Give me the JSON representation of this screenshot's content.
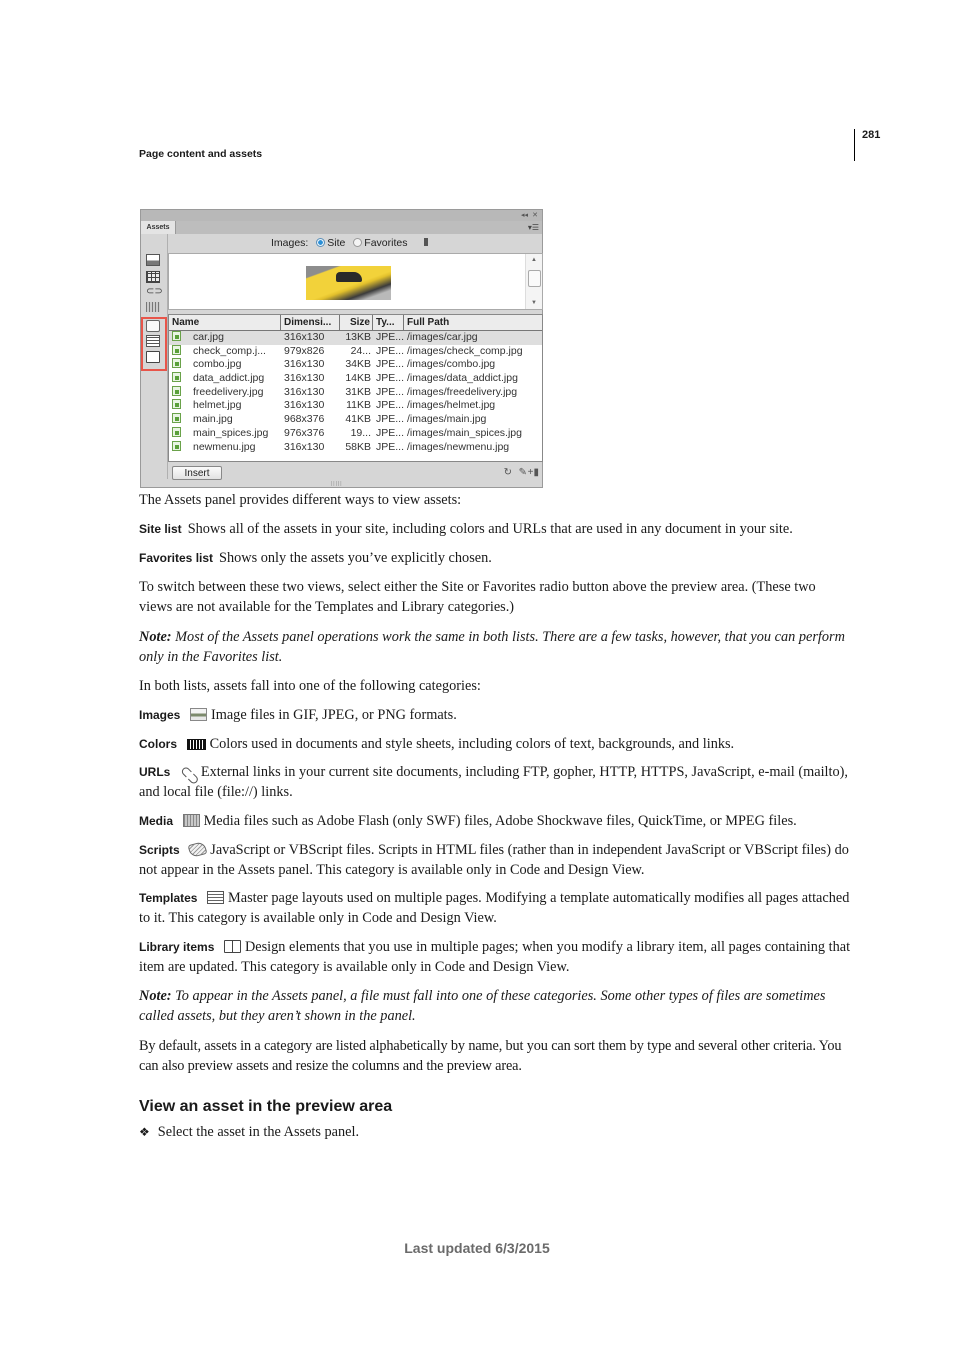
{
  "header": {
    "page_number": "281",
    "running_head": "Page content and assets"
  },
  "panel": {
    "tab_label": "Assets",
    "titlebar_icons": [
      "collapse-icon",
      "close-icon"
    ],
    "category_label": "Images:",
    "radio_site": "Site",
    "radio_favorites": "Favorites",
    "selected_view": "Site",
    "columns": [
      "Name",
      "Dimensi...",
      "Size",
      "Ty...",
      "Full Path"
    ],
    "rows": [
      {
        "name": "car.jpg",
        "dim": "316x130",
        "size": "13KB",
        "type": "JPE...",
        "path": "/images/car.jpg"
      },
      {
        "name": "check_comp.j...",
        "dim": "979x826",
        "size": "24...",
        "type": "JPE...",
        "path": "/images/check_comp.jpg"
      },
      {
        "name": "combo.jpg",
        "dim": "316x130",
        "size": "34KB",
        "type": "JPE...",
        "path": "/images/combo.jpg"
      },
      {
        "name": "data_addict.jpg",
        "dim": "316x130",
        "size": "14KB",
        "type": "JPE...",
        "path": "/images/data_addict.jpg"
      },
      {
        "name": "freedelivery.jpg",
        "dim": "316x130",
        "size": "31KB",
        "type": "JPE...",
        "path": "/images/freedelivery.jpg"
      },
      {
        "name": "helmet.jpg",
        "dim": "316x130",
        "size": "11KB",
        "type": "JPE...",
        "path": "/images/helmet.jpg"
      },
      {
        "name": "main.jpg",
        "dim": "968x376",
        "size": "41KB",
        "type": "JPE...",
        "path": "/images/main.jpg"
      },
      {
        "name": "main_spices.jpg",
        "dim": "976x376",
        "size": "19...",
        "type": "JPE...",
        "path": "/images/main_spices.jpg"
      },
      {
        "name": "newmenu.jpg",
        "dim": "316x130",
        "size": "58KB",
        "type": "JPE...",
        "path": "/images/newmenu.jpg"
      }
    ],
    "insert_label": "Insert",
    "highlight_color": "#e8554a"
  },
  "body": {
    "intro": "The Assets panel provides different ways to view assets:",
    "site_list_term": "Site list",
    "site_list_text": "Shows all of the assets in your site, including colors and URLs that are used in any document in your site.",
    "favorites_term": "Favorites list",
    "favorites_text": "Shows only the assets you’ve explicitly chosen.",
    "switch_text": "To switch between these two views, select either the Site or Favorites radio button above the preview area. (These two views are not available for the Templates and Library categories.)",
    "note1_label": "Note:",
    "note1_text": " Most of the Assets panel operations work the same in both lists. There are a few tasks, however, that you can perform only in the Favorites list.",
    "categories_intro": "In both lists, assets fall into one of the following categories:",
    "categories": [
      {
        "term": "Images",
        "icon": "image-icon",
        "text": "Image files in GIF, JPEG, or PNG formats."
      },
      {
        "term": "Colors",
        "icon": "color-grid-icon",
        "text": "Colors used in documents and style sheets, including colors of text, backgrounds, and links."
      },
      {
        "term": "URLs",
        "icon": "chain-link-icon",
        "text": "External links in your current site documents, including FTP, gopher, HTTP, HTTPS, JavaScript, e-mail (mailto), and local file (file://) links."
      },
      {
        "term": "Media",
        "icon": "film-icon",
        "text": "Media files such as Adobe Flash (only SWF) files, Adobe Shockwave files, QuickTime, or MPEG files."
      },
      {
        "term": "Scripts",
        "icon": "script-scroll-icon",
        "text": "JavaScript or VBScript files. Scripts in HTML files (rather than in independent JavaScript or VBScript files) do not appear in the Assets panel. This category is available only in Code and Design View."
      },
      {
        "term": "Templates",
        "icon": "template-icon",
        "text": "Master page layouts used on multiple pages. Modifying a template automatically modifies all pages attached to it. This category is available only in Code and Design View."
      },
      {
        "term": "Library items",
        "icon": "book-icon",
        "text": "Design elements that you use in multiple pages; when you modify a library item, all pages containing that item are updated. This category is available only in Code and Design View."
      }
    ],
    "note2_label": "Note:",
    "note2_text": " To appear in the Assets panel, a file must fall into one of these categories. Some other types of files are sometimes called assets, but they aren’t shown in the panel.",
    "sorting_text": "By default, assets in a category are listed alphabetically by name, but you can sort them by type and several other criteria. You can also preview assets and resize the columns and the preview area.",
    "heading": "View an asset in the preview area",
    "bullet_glyph": "❖",
    "step": "Select the asset in the Assets panel."
  },
  "footer": {
    "last_updated": "Last updated 6/3/2015"
  }
}
